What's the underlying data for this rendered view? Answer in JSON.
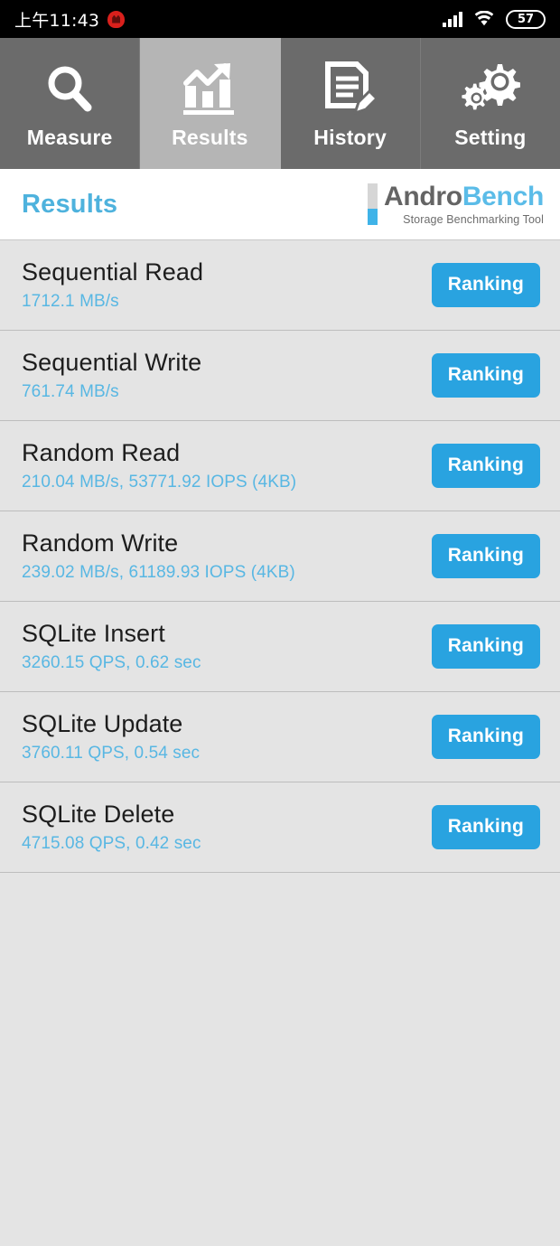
{
  "statusbar": {
    "time": "上午11:43",
    "app_icon": "antutu-icon",
    "signal_icon": "cellular-signal-icon",
    "wifi_icon": "wifi-icon",
    "battery_level": "57"
  },
  "tabs": [
    {
      "label": "Measure",
      "icon": "magnifier-icon",
      "active": false
    },
    {
      "label": "Results",
      "icon": "bar-chart-arrow-icon",
      "active": true
    },
    {
      "label": "History",
      "icon": "document-pencil-icon",
      "active": false
    },
    {
      "label": "Setting",
      "icon": "gears-icon",
      "active": false
    }
  ],
  "header": {
    "title": "Results",
    "brand_name_part1": "Andro",
    "brand_name_part2": "Bench",
    "brand_tagline": "Storage Benchmarking Tool"
  },
  "colors": {
    "accent_blue": "#29a3e0",
    "title_blue": "#4eb2dd",
    "value_blue": "#58b7e3",
    "tab_inactive": "#6b6b6b",
    "tab_active": "#b5b5b5",
    "body_bg": "#e4e4e4"
  },
  "results": [
    {
      "name": "Sequential Read",
      "value": "1712.1 MB/s",
      "button": "Ranking"
    },
    {
      "name": "Sequential Write",
      "value": "761.74 MB/s",
      "button": "Ranking"
    },
    {
      "name": "Random Read",
      "value": "210.04 MB/s, 53771.92 IOPS (4KB)",
      "button": "Ranking"
    },
    {
      "name": "Random Write",
      "value": "239.02 MB/s, 61189.93 IOPS (4KB)",
      "button": "Ranking"
    },
    {
      "name": "SQLite Insert",
      "value": "3260.15 QPS, 0.62 sec",
      "button": "Ranking"
    },
    {
      "name": "SQLite Update",
      "value": "3760.11 QPS, 0.54 sec",
      "button": "Ranking"
    },
    {
      "name": "SQLite Delete",
      "value": "4715.08 QPS, 0.42 sec",
      "button": "Ranking"
    }
  ]
}
